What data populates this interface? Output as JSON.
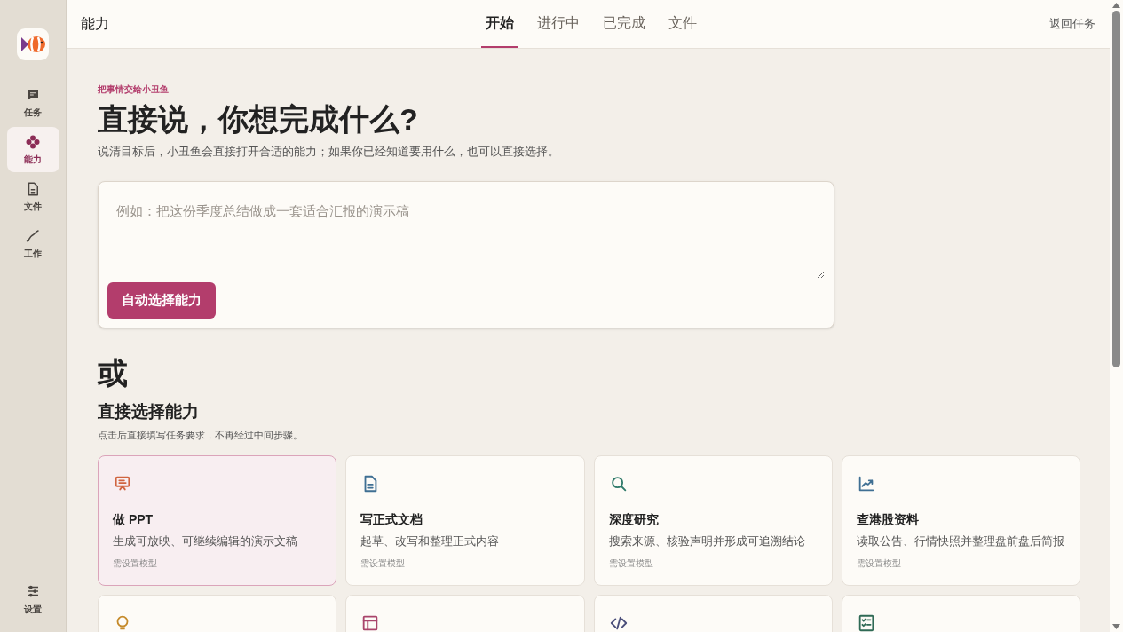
{
  "sidebar": {
    "items": [
      {
        "label": "任务",
        "kind": "chat",
        "selected": false
      },
      {
        "label": "能力",
        "kind": "flower",
        "selected": true
      },
      {
        "label": "文件",
        "kind": "file",
        "selected": false
      },
      {
        "label": "工作",
        "kind": "curve",
        "selected": false
      }
    ],
    "settings": {
      "label": "设置"
    }
  },
  "header": {
    "title": "能力",
    "tabs": [
      {
        "label": "开始",
        "selected": true
      },
      {
        "label": "进行中",
        "selected": false
      },
      {
        "label": "已完成",
        "selected": false
      },
      {
        "label": "文件",
        "selected": false
      }
    ],
    "back_link": "返回任务"
  },
  "intro": {
    "eyebrow": "把事情交给小丑鱼",
    "heading": "直接说，你想完成什么?",
    "description": "说清目标后，小丑鱼会直接打开合适的能力；如果你已经知道要用什么，也可以直接选择。"
  },
  "prompt": {
    "placeholder": "例如：把这份季度总结做成一套适合汇报的演示稿",
    "button": "自动选择能力"
  },
  "or_label": "或",
  "capabilities": {
    "title": "直接选择能力",
    "subtitle": "点击后直接填写任务要求，不再经过中间步骤。",
    "cards": [
      {
        "kind": "presentation",
        "title": "做 PPT",
        "description": "生成可放映、可继续编辑的演示文稿",
        "note": "需设置模型",
        "selected": true
      },
      {
        "kind": "document",
        "title": "写正式文档",
        "description": "起草、改写和整理正式内容",
        "note": "需设置模型",
        "selected": false
      },
      {
        "kind": "search",
        "title": "深度研究",
        "description": "搜索来源、核验声明并形成可追溯结论",
        "note": "需设置模型",
        "selected": false
      },
      {
        "kind": "chart",
        "title": "查港股资料",
        "description": "读取公告、行情快照并整理盘前盘后简报",
        "note": "需设置模型",
        "selected": false
      },
      {
        "kind": "bulb",
        "selected": false
      },
      {
        "kind": "layout",
        "selected": false
      },
      {
        "kind": "code",
        "selected": false
      },
      {
        "kind": "checklist",
        "selected": false
      }
    ]
  }
}
